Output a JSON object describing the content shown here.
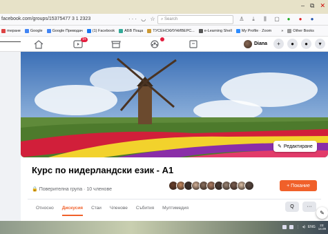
{
  "browser": {
    "url": "facebook.com/groups/15375477 3 1 2323",
    "search_placeholder": "Search",
    "window_controls": [
      "–",
      "⧉",
      "✕"
    ]
  },
  "bookmarks": [
    {
      "label": "mepaнe",
      "color": "#d44"
    },
    {
      "label": "Google",
      "color": "#4285f4"
    },
    {
      "label": "Google Преводач",
      "color": "#4285f4"
    },
    {
      "label": "(1) Facebook",
      "color": "#1877f2"
    },
    {
      "label": "АБВ Поща",
      "color": "#3a9"
    },
    {
      "label": "ТУСЕНСКИУНИВЕРС...",
      "color": "#c93"
    },
    {
      "label": "e-Learning Shell",
      "color": "#555"
    },
    {
      "label": "My Profile · Zoom",
      "color": "#2d8cff"
    },
    {
      "label": "»",
      "color": "transparent"
    },
    {
      "label": "Other Books",
      "color": "#999"
    }
  ],
  "fb_nav": {
    "user_name": "Diana",
    "watch_badge": "9+",
    "groups_badge": "",
    "right_icons": [
      "plus-icon",
      "messenger-icon",
      "bell-icon",
      "caret-icon"
    ]
  },
  "cover": {
    "edit_label": "Редактиране"
  },
  "group": {
    "title": "Курс по нидерландски език - A1",
    "privacy": "Поверителна група · 10 членове",
    "invite_label": "+ Покание",
    "member_colors": [
      "#6b3f2a",
      "#c98a5f",
      "#3c2f2a",
      "#d7b49a",
      "#8a6f5e",
      "#b07d62",
      "#4a3a33",
      "#9c8676",
      "#7a5d4f",
      "#e0c3a8",
      "#5a4a42"
    ]
  },
  "tabs": [
    {
      "label": "Относно",
      "active": false
    },
    {
      "label": "Дискусия",
      "active": true
    },
    {
      "label": "Стаи",
      "active": false
    },
    {
      "label": "Членове",
      "active": false
    },
    {
      "label": "Събития",
      "active": false
    },
    {
      "label": "Мултимедия",
      "active": false
    }
  ],
  "tab_actions": {
    "search": "Q",
    "more": "···"
  },
  "taskbar": {
    "lang": "ENG",
    "time": "23:",
    "date": "14.09"
  }
}
